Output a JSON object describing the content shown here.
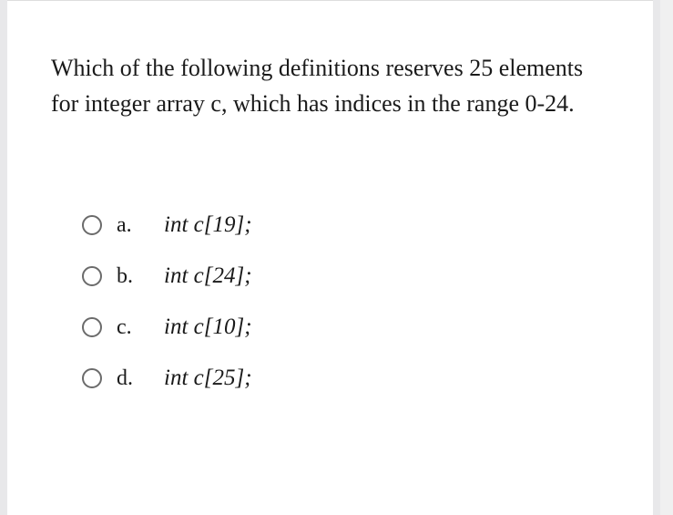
{
  "question": "Which of the following definitions reserves 25 elements for integer array c, which has indices in the range 0-24.",
  "options": [
    {
      "letter": "a.",
      "text": "int c[19];"
    },
    {
      "letter": "b.",
      "text": "int c[24];"
    },
    {
      "letter": "c.",
      "text": "int c[10];"
    },
    {
      "letter": "d.",
      "text": "int c[25];"
    }
  ]
}
